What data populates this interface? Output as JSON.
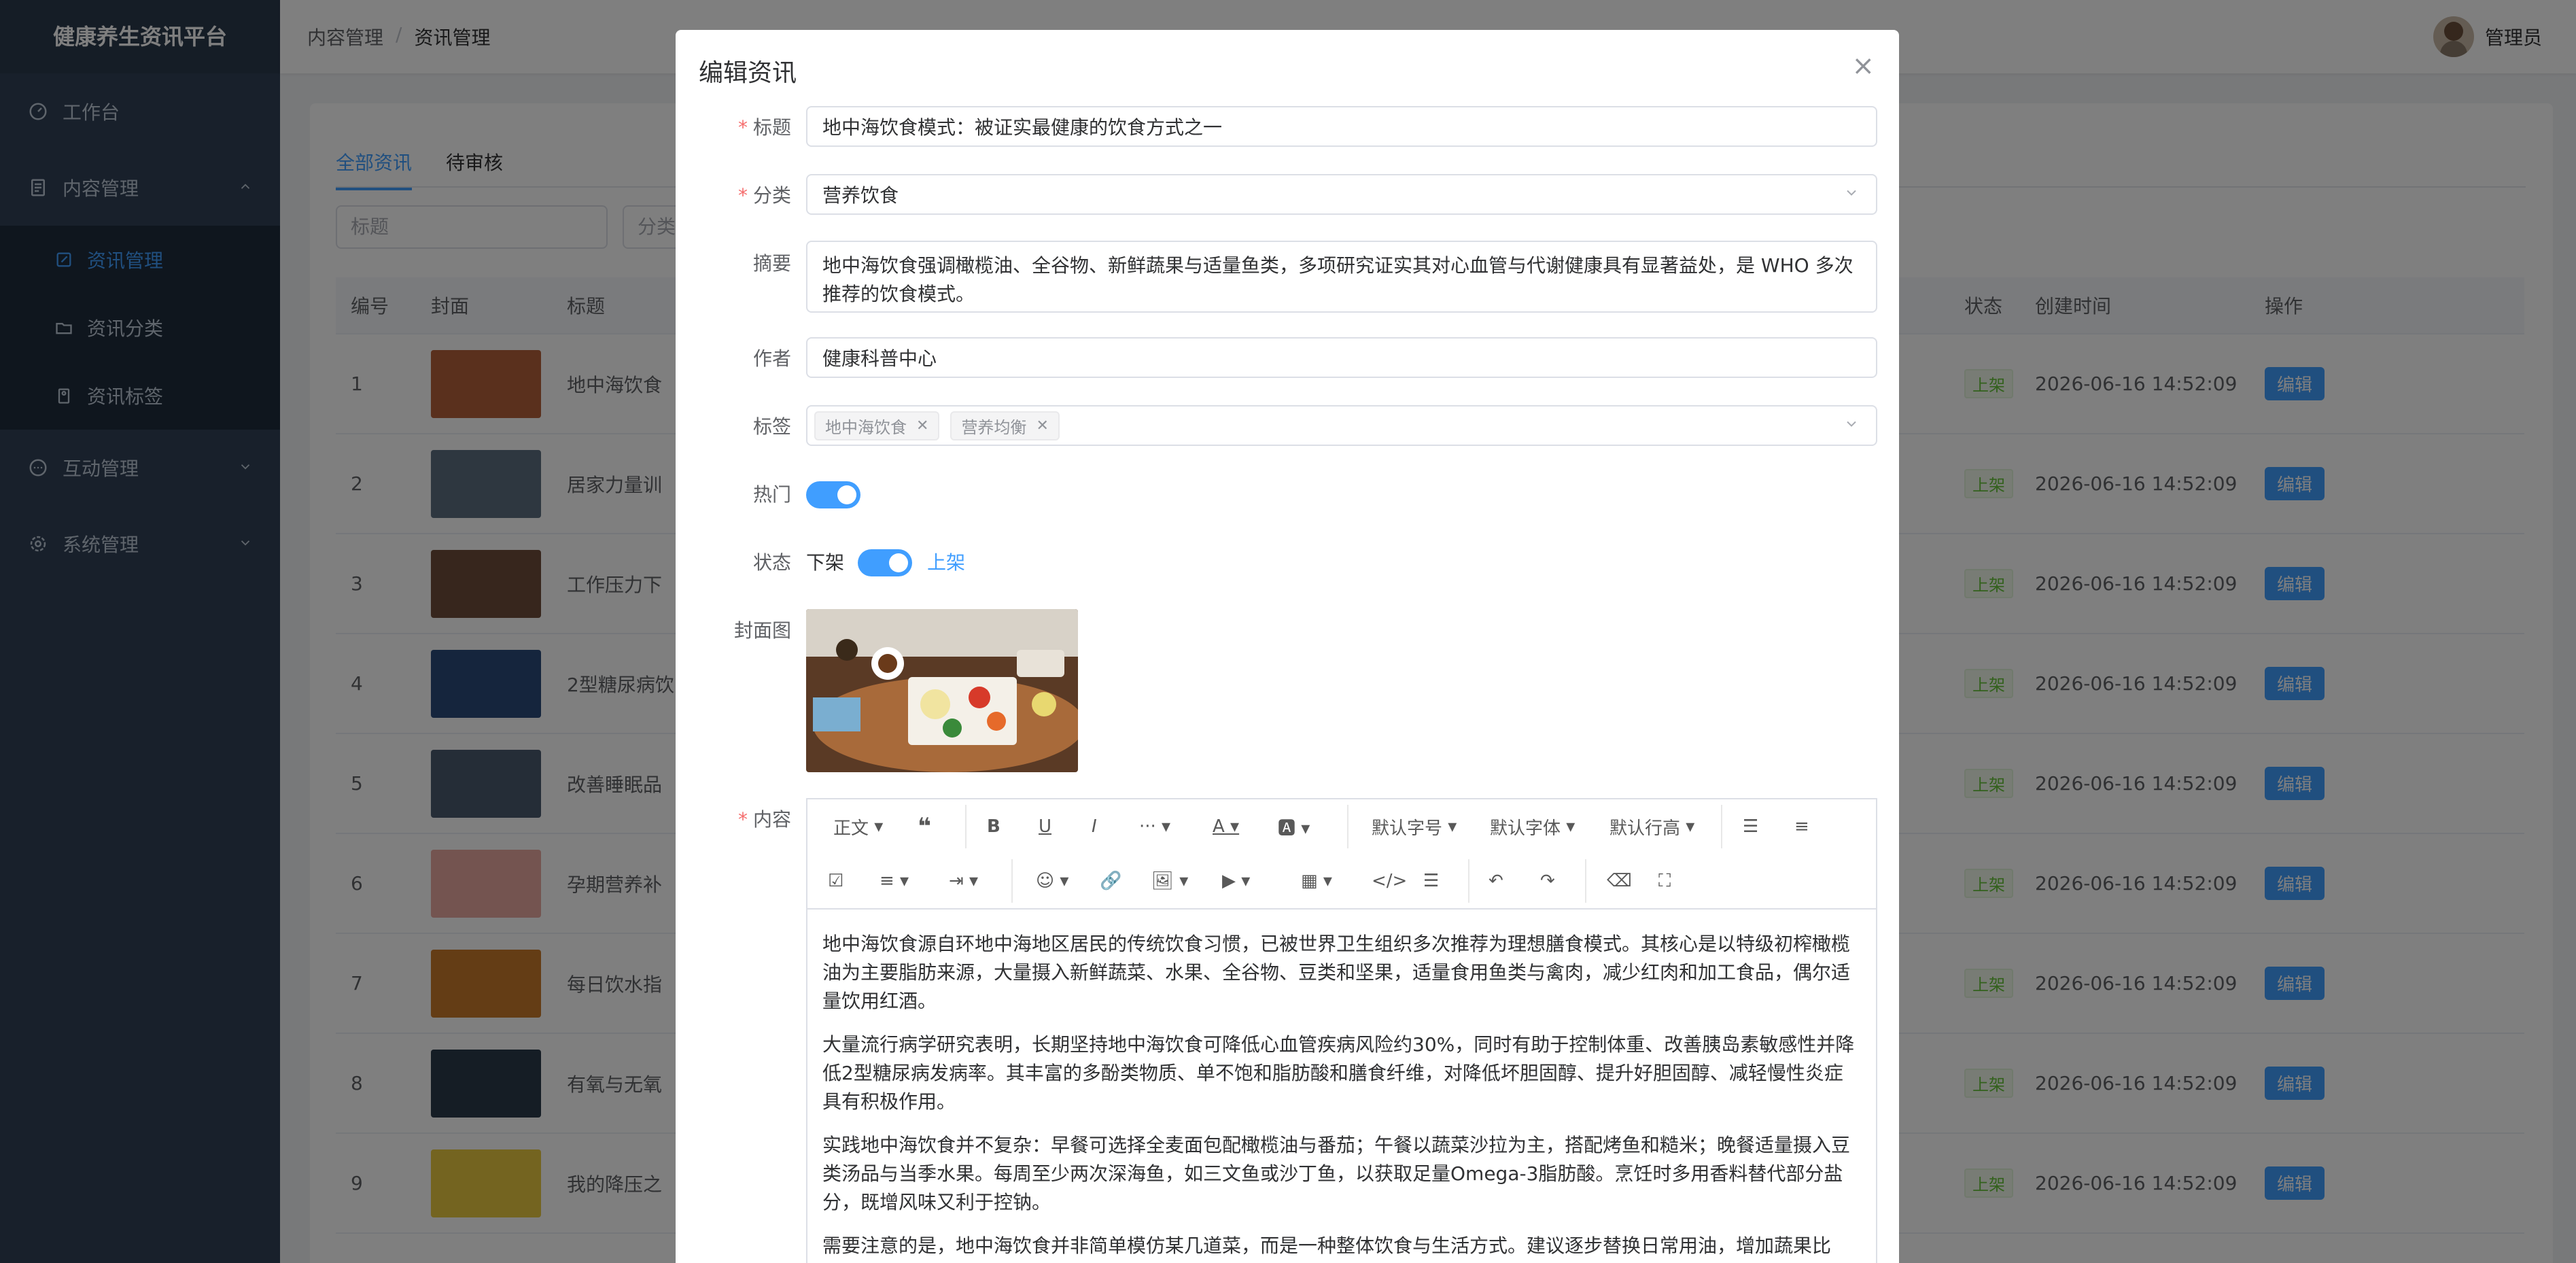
{
  "app": {
    "title": "健康养生资讯平台"
  },
  "sidebar": {
    "items": [
      {
        "label": "工作台",
        "icon": "dashboard-icon"
      },
      {
        "label": "内容管理",
        "icon": "document-icon",
        "expanded": true,
        "children": [
          {
            "label": "资讯管理",
            "icon": "edit-icon",
            "active": true
          },
          {
            "label": "资讯分类",
            "icon": "folder-icon"
          },
          {
            "label": "资讯标签",
            "icon": "tag-icon"
          }
        ]
      },
      {
        "label": "互动管理",
        "icon": "chat-icon"
      },
      {
        "label": "系统管理",
        "icon": "gear-icon"
      }
    ]
  },
  "header": {
    "breadcrumb": [
      "内容管理",
      "资讯管理"
    ],
    "user": "管理员"
  },
  "main": {
    "tabs": [
      {
        "label": "全部资讯",
        "active": true
      },
      {
        "label": "待审核"
      }
    ],
    "filters": {
      "title_placeholder": "标题",
      "category_placeholder": "分类"
    },
    "columns": [
      "编号",
      "封面",
      "标题",
      "状态",
      "创建时间",
      "操作"
    ],
    "rows": [
      {
        "no": "1",
        "title": "地中海饮食",
        "status": "上架",
        "time": "2026-06-16 14:52:09",
        "color": "#b5603a"
      },
      {
        "no": "2",
        "title": "居家力量训",
        "status": "上架",
        "time": "2026-06-16 14:52:09",
        "color": "#5c6e80"
      },
      {
        "no": "3",
        "title": "工作压力下",
        "status": "上架",
        "time": "2026-06-16 14:52:09",
        "color": "#6e4d3a"
      },
      {
        "no": "4",
        "title": "2型糖尿病饮",
        "status": "上架",
        "time": "2026-06-16 14:52:09",
        "color": "#2a4a7a"
      },
      {
        "no": "5",
        "title": "改善睡眠品",
        "status": "上架",
        "time": "2026-06-16 14:52:09",
        "color": "#4a5a6e"
      },
      {
        "no": "6",
        "title": "孕期营养补",
        "status": "上架",
        "time": "2026-06-16 14:52:09",
        "color": "#e8a8a0"
      },
      {
        "no": "7",
        "title": "每日饮水指",
        "status": "上架",
        "time": "2026-06-16 14:52:09",
        "color": "#c87a2a"
      },
      {
        "no": "8",
        "title": "有氧与无氧",
        "status": "上架",
        "time": "2026-06-16 14:52:09",
        "color": "#2a3a4a"
      },
      {
        "no": "9",
        "title": "我的降压之",
        "status": "上架",
        "time": "2026-06-16 14:52:09",
        "color": "#e8c840"
      }
    ],
    "edit_label": "编辑"
  },
  "dialog": {
    "title": "编辑资讯",
    "labels": {
      "title": "标题",
      "category": "分类",
      "summary": "摘要",
      "author": "作者",
      "tags": "标签",
      "hot": "热门",
      "status": "状态",
      "cover": "封面图",
      "content": "内容"
    },
    "values": {
      "title": "地中海饮食模式：被证实最健康的饮食方式之一",
      "category": "营养饮食",
      "summary": "地中海饮食强调橄榄油、全谷物、新鲜蔬果与适量鱼类，多项研究证实其对心血管与代谢健康具有显著益处，是 WHO 多次推荐的饮食模式。",
      "author": "健康科普中心",
      "tags": [
        "地中海饮食",
        "营养均衡"
      ],
      "status_off": "下架",
      "status_on": "上架"
    },
    "toolbar": {
      "heading": "正文",
      "font_size": "默认字号",
      "font_family": "默认字体",
      "line_height": "默认行高"
    },
    "content": [
      "地中海饮食源自环地中海地区居民的传统饮食习惯，已被世界卫生组织多次推荐为理想膳食模式。其核心是以特级初榨橄榄油为主要脂肪来源，大量摄入新鲜蔬菜、水果、全谷物、豆类和坚果，适量食用鱼类与禽肉，减少红肉和加工食品，偶尔适量饮用红酒。",
      "大量流行病学研究表明，长期坚持地中海饮食可降低心血管疾病风险约30%，同时有助于控制体重、改善胰岛素敏感性并降低2型糖尿病发病率。其丰富的多酚类物质、单不饱和脂肪酸和膳食纤维，对降低坏胆固醇、提升好胆固醇、减轻慢性炎症具有积极作用。",
      "实践地中海饮食并不复杂：早餐可选择全麦面包配橄榄油与番茄；午餐以蔬菜沙拉为主，搭配烤鱼和糙米；晚餐适量摄入豆类汤品与当季水果。每周至少两次深海鱼，如三文鱼或沙丁鱼，以获取足量Omega-3脂肪酸。烹饪时多用香料替代部分盐分，既增风味又利于控钠。",
      "需要注意的是，地中海饮食并非简单模仿某几道菜，而是一种整体饮食与生活方式。建议逐步替换日常用油，增加蔬果比"
    ]
  },
  "colors": {
    "accent": "#409eff",
    "sidebar_bg": "#304156",
    "success": "#67c23a",
    "danger": "#f56c6c"
  }
}
